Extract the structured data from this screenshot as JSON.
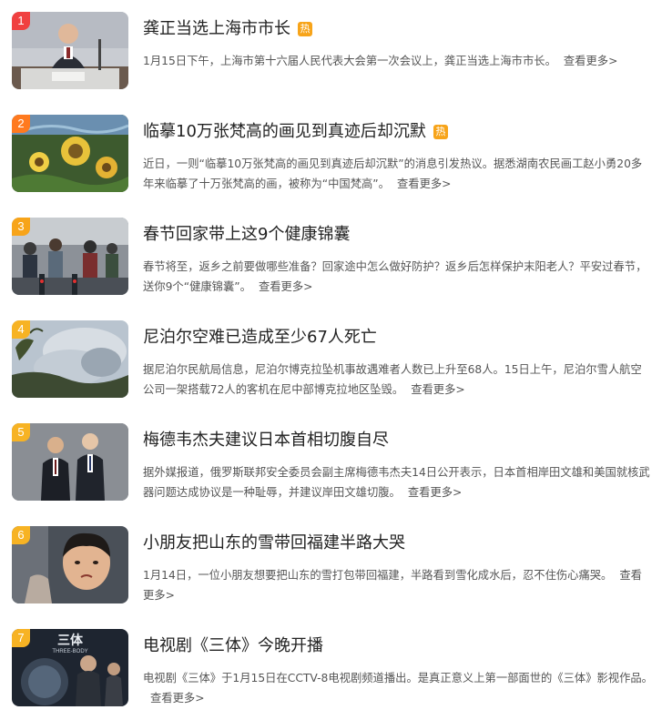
{
  "colors": {
    "rank_1": "#f04040",
    "rank_2": "#ff7a1f",
    "rank_3": "#f7a41a",
    "rank_rest": "#f7b324",
    "hot_badge": "#f7a41a"
  },
  "news": [
    {
      "rank": "1",
      "title": "龚正当选上海市市长",
      "hot": "热",
      "desc": "1月15日下午，上海市第十六届人民代表大会第一次会议上，龚正当选上海市市长。",
      "more": "查看更多>",
      "image_icon": "photo-official-speaking"
    },
    {
      "rank": "2",
      "title": "临摹10万张梵高的画见到真迹后却沉默",
      "hot": "热",
      "desc": "近日，一则“临摹10万张梵高的画见到真迹后却沉默”的消息引发热议。据悉湖南农民画工赵小勇20多年来临摹了十万张梵高的画，被称为“中国梵高”。",
      "more": "查看更多>",
      "image_icon": "photo-painting"
    },
    {
      "rank": "3",
      "title": "春节回家带上这9个健康锦囊",
      "hot": "",
      "desc": "春节将至，返乡之前要做哪些准备？回家途中怎么做好防护？返乡后怎样保护末阳老人？平安过春节，送你9个“健康锦囊”。",
      "more": "查看更多>",
      "image_icon": "photo-station-crowd"
    },
    {
      "rank": "4",
      "title": "尼泊尔空难已造成至少67人死亡",
      "hot": "",
      "desc": "据尼泊尔民航局信息，尼泊尔博克拉坠机事故遇难者人数已上升至68人。15日上午，尼泊尔雪人航空公司一架搭载72人的客机在尼中部博克拉地区坠毁。",
      "more": "查看更多>",
      "image_icon": "photo-crash-smoke"
    },
    {
      "rank": "5",
      "title": "梅德韦杰夫建议日本首相切腹自尽",
      "hot": "",
      "desc": "据外媒报道，俄罗斯联邦安全委员会副主席梅德韦杰夫14日公开表示，日本首相岸田文雄和美国就核武器问题达成协议是一种耻辱，并建议岸田文雄切腹。",
      "more": "查看更多>",
      "image_icon": "photo-two-leaders"
    },
    {
      "rank": "6",
      "title": "小朋友把山东的雪带回福建半路大哭",
      "hot": "",
      "desc": "1月14日，一位小朋友想要把山东的雪打包带回福建，半路看到雪化成水后，忍不住伤心痛哭。",
      "more": "查看更多>",
      "image_icon": "photo-child-crying"
    },
    {
      "rank": "7",
      "title": "电视剧《三体》今晚开播",
      "hot": "",
      "desc": "电视剧《三体》于1月15日在CCTV-8电视剧频道播出。是真正意义上第一部面世的《三体》影视作品。",
      "more": "查看更多>",
      "image_icon": "photo-tv-poster",
      "poster_text": "三体",
      "poster_sub": "THREE-BODY"
    }
  ]
}
